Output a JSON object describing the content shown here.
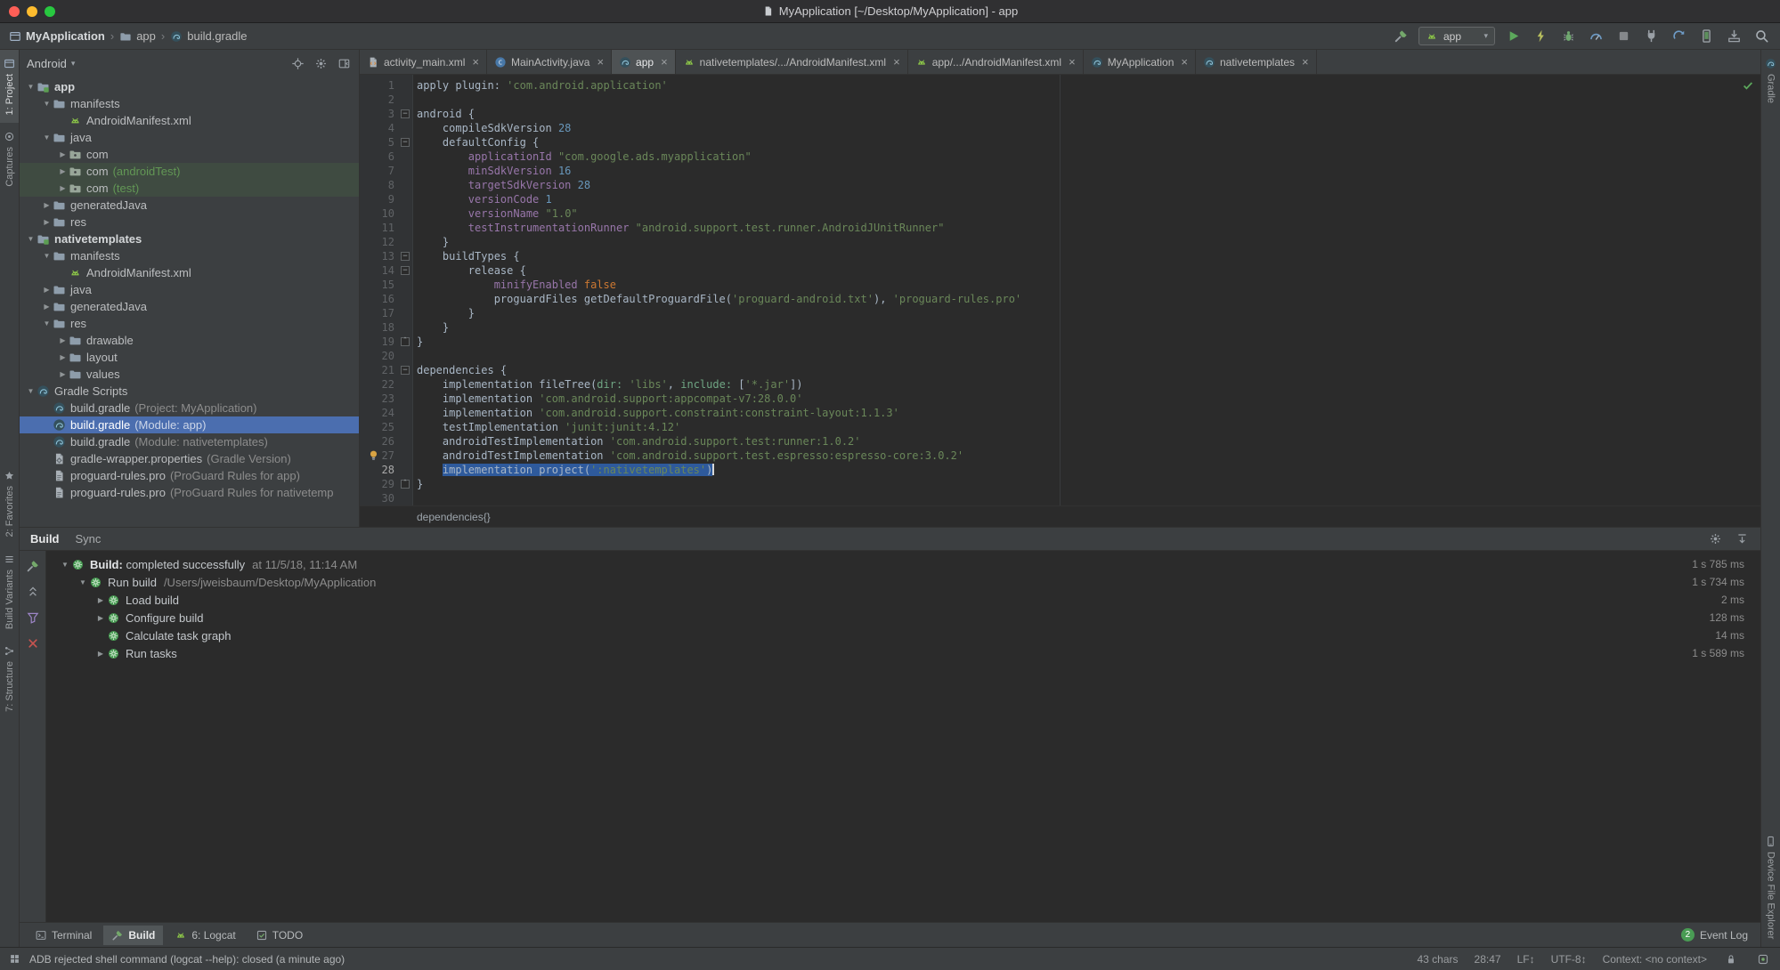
{
  "window": {
    "title": "MyApplication [~/Desktop/MyApplication] - app"
  },
  "toolbar": {
    "breadcrumbs": [
      {
        "icon": "project-icon",
        "label": "MyApplication",
        "bold": true
      },
      {
        "icon": "folder-icon",
        "label": "app",
        "bold": false
      },
      {
        "icon": "gradle-icon",
        "label": "build.gradle",
        "bold": false
      }
    ],
    "left_icons": [
      "build-hammer-icon"
    ],
    "run_config": {
      "icon": "android-icon",
      "label": "app"
    },
    "right_icons": [
      "run-icon",
      "apply-changes-icon",
      "debug-icon",
      "profiler-icon",
      "stop-icon",
      "attach-debugger-icon",
      "sync-gradle-icon",
      "device-manager-icon",
      "sdk-manager-icon",
      "search-icon"
    ]
  },
  "left_strip": {
    "top": [
      {
        "id": "project",
        "icon": "project-tool-icon",
        "label": "1: Project",
        "active": true
      },
      {
        "id": "captures",
        "icon": "captures-tool-icon",
        "label": "Captures",
        "active": false
      }
    ],
    "middle": [
      {
        "id": "favorites",
        "icon": "favorites-tool-icon",
        "label": "2: Favorites",
        "active": false
      },
      {
        "id": "build-variants",
        "icon": "build-variants-tool-icon",
        "label": "Build Variants",
        "active": false
      },
      {
        "id": "structure",
        "icon": "structure-tool-icon",
        "label": "7: Structure",
        "active": false
      }
    ]
  },
  "right_strip": {
    "top": [
      {
        "id": "gradle",
        "icon": "gradle-tool-icon",
        "label": "Gradle",
        "active": false
      }
    ],
    "bottom": [
      {
        "id": "device-file-explorer",
        "icon": "device-tool-icon",
        "label": "Device File Explorer",
        "active": false
      }
    ]
  },
  "project_panel": {
    "view": "Android",
    "header_icons": [
      "locate-icon",
      "settings-icon",
      "hide-icon"
    ],
    "tree": [
      {
        "d": 0,
        "a": "v",
        "i": "module-icon",
        "l": "app",
        "b": true
      },
      {
        "d": 1,
        "a": "v",
        "i": "folder-icon",
        "l": "manifests"
      },
      {
        "d": 2,
        "a": "",
        "i": "manifest-icon",
        "l": "AndroidManifest.xml"
      },
      {
        "d": 1,
        "a": "v",
        "i": "folder-icon",
        "l": "java"
      },
      {
        "d": 2,
        "a": ">",
        "i": "package-icon",
        "l": "com"
      },
      {
        "d": 2,
        "a": ">",
        "i": "package-icon",
        "l": "com",
        "m": "(androidTest)",
        "mg": true,
        "hl": true
      },
      {
        "d": 2,
        "a": ">",
        "i": "package-icon",
        "l": "com",
        "m": "(test)",
        "mg": true,
        "hl": true
      },
      {
        "d": 1,
        "a": ">",
        "i": "folder-icon",
        "l": "generatedJava"
      },
      {
        "d": 1,
        "a": ">",
        "i": "folder-icon",
        "l": "res"
      },
      {
        "d": 0,
        "a": "v",
        "i": "module-icon",
        "l": "nativetemplates",
        "b": true
      },
      {
        "d": 1,
        "a": "v",
        "i": "folder-icon",
        "l": "manifests"
      },
      {
        "d": 2,
        "a": "",
        "i": "manifest-icon",
        "l": "AndroidManifest.xml"
      },
      {
        "d": 1,
        "a": ">",
        "i": "folder-icon",
        "l": "java"
      },
      {
        "d": 1,
        "a": ">",
        "i": "folder-icon",
        "l": "generatedJava"
      },
      {
        "d": 1,
        "a": "v",
        "i": "folder-icon",
        "l": "res"
      },
      {
        "d": 2,
        "a": ">",
        "i": "folder-icon",
        "l": "drawable"
      },
      {
        "d": 2,
        "a": ">",
        "i": "folder-icon",
        "l": "layout"
      },
      {
        "d": 2,
        "a": ">",
        "i": "folder-icon",
        "l": "values"
      },
      {
        "d": 0,
        "a": "v",
        "i": "gradle-icon",
        "l": "Gradle Scripts"
      },
      {
        "d": 1,
        "a": "",
        "i": "gradle-icon",
        "l": "build.gradle",
        "m": "(Project: MyApplication)"
      },
      {
        "d": 1,
        "a": "",
        "i": "gradle-icon",
        "l": "build.gradle",
        "m": "(Module: app)",
        "sel": true
      },
      {
        "d": 1,
        "a": "",
        "i": "gradle-icon",
        "l": "build.gradle",
        "m": "(Module: nativetemplates)"
      },
      {
        "d": 1,
        "a": "",
        "i": "wrench-file-icon",
        "l": "gradle-wrapper.properties",
        "m": "(Gradle Version)"
      },
      {
        "d": 1,
        "a": "",
        "i": "file-icon",
        "l": "proguard-rules.pro",
        "m": "(ProGuard Rules for app)"
      },
      {
        "d": 1,
        "a": "",
        "i": "file-icon",
        "l": "proguard-rules.pro",
        "m": "(ProGuard Rules for nativetemp"
      }
    ]
  },
  "editor": {
    "tabs": [
      {
        "icon": "layout-file-icon",
        "label": "activity_main.xml",
        "active": false
      },
      {
        "icon": "class-icon",
        "label": "MainActivity.java",
        "active": false
      },
      {
        "icon": "gradle-icon",
        "label": "app",
        "active": true
      },
      {
        "icon": "manifest-icon",
        "label": "nativetemplates/.../AndroidManifest.xml",
        "active": false
      },
      {
        "icon": "manifest-icon",
        "label": "app/.../AndroidManifest.xml",
        "active": false
      },
      {
        "icon": "gradle-icon",
        "label": "MyApplication",
        "active": false
      },
      {
        "icon": "gradle-icon",
        "label": "nativetemplates",
        "active": false
      }
    ],
    "breadcrumb": "dependencies{}",
    "lines": [
      {
        "n": 1,
        "s": [
          [
            "p",
            "apply plugin: "
          ],
          [
            "s",
            "'com.android.application'"
          ]
        ]
      },
      {
        "n": 2,
        "s": []
      },
      {
        "n": 3,
        "f": "-",
        "s": [
          [
            "p",
            "android {"
          ]
        ]
      },
      {
        "n": 4,
        "s": [
          [
            "p",
            "    compileSdkVersion "
          ],
          [
            "n",
            "28"
          ]
        ]
      },
      {
        "n": 5,
        "f": "-",
        "s": [
          [
            "p",
            "    defaultConfig {"
          ]
        ]
      },
      {
        "n": 6,
        "s": [
          [
            "p",
            "        "
          ],
          [
            "v",
            "applicationId"
          ],
          [
            "p",
            " "
          ],
          [
            "s",
            "\"com.google.ads.myapplication\""
          ]
        ]
      },
      {
        "n": 7,
        "s": [
          [
            "p",
            "        "
          ],
          [
            "v",
            "minSdkVersion"
          ],
          [
            "p",
            " "
          ],
          [
            "n",
            "16"
          ]
        ]
      },
      {
        "n": 8,
        "s": [
          [
            "p",
            "        "
          ],
          [
            "v",
            "targetSdkVersion"
          ],
          [
            "p",
            " "
          ],
          [
            "n",
            "28"
          ]
        ]
      },
      {
        "n": 9,
        "s": [
          [
            "p",
            "        "
          ],
          [
            "v",
            "versionCode"
          ],
          [
            "p",
            " "
          ],
          [
            "n",
            "1"
          ]
        ]
      },
      {
        "n": 10,
        "s": [
          [
            "p",
            "        "
          ],
          [
            "v",
            "versionName"
          ],
          [
            "p",
            " "
          ],
          [
            "s",
            "\"1.0\""
          ]
        ]
      },
      {
        "n": 11,
        "s": [
          [
            "p",
            "        "
          ],
          [
            "v",
            "testInstrumentationRunner"
          ],
          [
            "p",
            " "
          ],
          [
            "s",
            "\"android.support.test.runner.AndroidJUnitRunner\""
          ]
        ]
      },
      {
        "n": 12,
        "s": [
          [
            "p",
            "    }"
          ]
        ]
      },
      {
        "n": 13,
        "f": "-",
        "s": [
          [
            "p",
            "    buildTypes {"
          ]
        ]
      },
      {
        "n": 14,
        "f": "-",
        "s": [
          [
            "p",
            "        release {"
          ]
        ]
      },
      {
        "n": 15,
        "s": [
          [
            "p",
            "            "
          ],
          [
            "v",
            "minifyEnabled"
          ],
          [
            "p",
            " "
          ],
          [
            "k",
            "false"
          ]
        ]
      },
      {
        "n": 16,
        "s": [
          [
            "p",
            "            proguardFiles getDefaultProguardFile("
          ],
          [
            "s",
            "'proguard-android.txt'"
          ],
          [
            "p",
            "), "
          ],
          [
            "s",
            "'proguard-rules.pro'"
          ]
        ]
      },
      {
        "n": 17,
        "s": [
          [
            "p",
            "        }"
          ]
        ]
      },
      {
        "n": 18,
        "s": [
          [
            "p",
            "    }"
          ]
        ]
      },
      {
        "n": 19,
        "f": "^",
        "s": [
          [
            "p",
            "}"
          ]
        ]
      },
      {
        "n": 20,
        "s": []
      },
      {
        "n": 21,
        "f": "-",
        "s": [
          [
            "p",
            "dependencies {"
          ]
        ]
      },
      {
        "n": 22,
        "s": [
          [
            "p",
            "    implementation fileTree("
          ],
          [
            "m",
            "dir:"
          ],
          [
            "p",
            " "
          ],
          [
            "s",
            "'libs'"
          ],
          [
            "p",
            ", "
          ],
          [
            "m",
            "include:"
          ],
          [
            "p",
            " ["
          ],
          [
            "s",
            "'*.jar'"
          ],
          [
            "p",
            "])"
          ]
        ]
      },
      {
        "n": 23,
        "s": [
          [
            "p",
            "    implementation "
          ],
          [
            "s",
            "'com.android.support:appcompat-v7:28.0.0'"
          ]
        ]
      },
      {
        "n": 24,
        "s": [
          [
            "p",
            "    implementation "
          ],
          [
            "s",
            "'com.android.support.constraint:constraint-layout:1.1.3'"
          ]
        ]
      },
      {
        "n": 25,
        "s": [
          [
            "p",
            "    testImplementation "
          ],
          [
            "s",
            "'junit:junit:4.12'"
          ]
        ]
      },
      {
        "n": 26,
        "s": [
          [
            "p",
            "    androidTestImplementation "
          ],
          [
            "s",
            "'com.android.support.test:runner:1.0.2'"
          ]
        ]
      },
      {
        "n": 27,
        "bulb": true,
        "s": [
          [
            "p",
            "    androidTestImplementation "
          ],
          [
            "s",
            "'com.android.support.test.espresso:espresso-core:3.0.2'"
          ]
        ]
      },
      {
        "n": 28,
        "sf": 1,
        "caret": true,
        "s": [
          [
            "p",
            "    "
          ],
          [
            "p",
            "implementation project("
          ],
          [
            "s",
            "':nativetemplates'"
          ],
          [
            "p",
            ")"
          ]
        ]
      },
      {
        "n": 29,
        "f": "^",
        "s": [
          [
            "p",
            "}"
          ]
        ]
      },
      {
        "n": 30,
        "s": []
      }
    ]
  },
  "build_panel": {
    "tabs": [
      {
        "label": "Build",
        "active": true
      },
      {
        "label": "Sync",
        "active": false
      }
    ],
    "header_icons": [
      "settings-icon",
      "collapse-icon"
    ],
    "tool_icons": [
      "rerun-hammer-icon",
      "collapse-all-icon",
      "filter-icon",
      "close-icon"
    ],
    "rows": [
      {
        "depth": 0,
        "arrow": "down",
        "icon": "gradle-task-icon",
        "bold_label": "Build: ",
        "label": "completed successfully",
        "meta": "at 11/5/18, 11:14 AM",
        "time": "1 s 785 ms"
      },
      {
        "depth": 1,
        "arrow": "down",
        "icon": "gradle-task-icon",
        "label": "Run build",
        "meta": "/Users/jweisbaum/Desktop/MyApplication",
        "time": "1 s 734 ms"
      },
      {
        "depth": 2,
        "arrow": "right",
        "icon": "gradle-task-icon",
        "label": "Load build",
        "time": "2 ms"
      },
      {
        "depth": 2,
        "arrow": "right",
        "icon": "gradle-task-icon",
        "label": "Configure build",
        "time": "128 ms"
      },
      {
        "depth": 2,
        "arrow": "none",
        "icon": "gradle-task-icon",
        "label": "Calculate task graph",
        "time": "14 ms"
      },
      {
        "depth": 2,
        "arrow": "right",
        "icon": "gradle-task-icon",
        "label": "Run tasks",
        "time": "1 s 589 ms"
      }
    ]
  },
  "bottom_bar": {
    "tabs": [
      {
        "icon": "terminal-icon",
        "label": "Terminal",
        "active": false
      },
      {
        "icon": "hammer-small-icon",
        "label": "Build",
        "active": true
      },
      {
        "icon": "logcat-icon",
        "label": "6: Logcat",
        "active": false
      },
      {
        "icon": "todo-icon",
        "label": "TODO",
        "active": false
      }
    ],
    "event_log": {
      "badge": "2",
      "label": "Event Log"
    }
  },
  "status_bar": {
    "message": "ADB rejected shell command (logcat --help): closed (a minute ago)",
    "items": [
      "43 chars",
      "28:47",
      "LF↕",
      "UTF-8↕",
      "Context: <no context>"
    ],
    "icons": [
      "lock-icon",
      "indicator-icon"
    ]
  },
  "colors": {
    "tree_selection": "#4B6EAF",
    "editor_selection": "#2E5A9C",
    "string": "#6A8759",
    "number": "#6897BB",
    "keyword": "#CC7832",
    "property": "#9876AA",
    "success_green": "#499C54"
  }
}
